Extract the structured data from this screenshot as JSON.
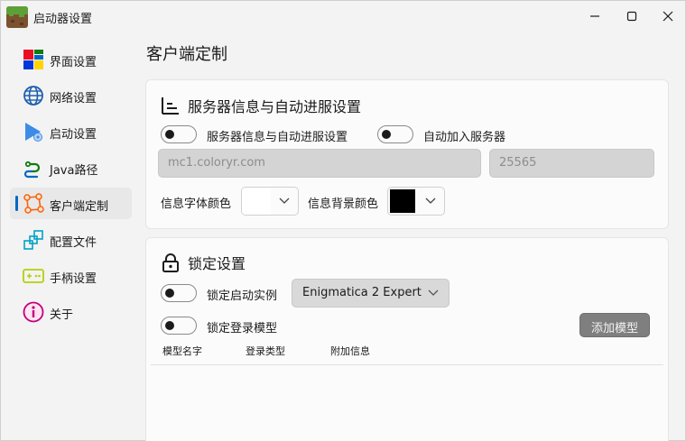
{
  "window": {
    "title": "启动器设置"
  },
  "sidebar": {
    "items": [
      {
        "label": "界面设置",
        "icon": "ui-settings-icon",
        "active": false
      },
      {
        "label": "网络设置",
        "icon": "globe-icon",
        "active": false
      },
      {
        "label": "启动设置",
        "icon": "launch-icon",
        "active": false
      },
      {
        "label": "Java路径",
        "icon": "java-path-icon",
        "active": false
      },
      {
        "label": "客户端定制",
        "icon": "client-custom-icon",
        "active": true
      },
      {
        "label": "配置文件",
        "icon": "config-file-icon",
        "active": false
      },
      {
        "label": "手柄设置",
        "icon": "gamepad-icon",
        "active": false
      },
      {
        "label": "关于",
        "icon": "info-icon",
        "active": false
      }
    ]
  },
  "main": {
    "page_title": "客户端定制",
    "server_section": {
      "title": "服务器信息与自动进服设置",
      "toggle1_label": "服务器信息与自动进服设置",
      "toggle2_label": "自动加入服务器",
      "address_placeholder": "mc1.coloryr.com",
      "port_placeholder": "25565",
      "font_color_label": "信息字体颜色",
      "font_color": "#ffffff",
      "bg_color_label": "信息背景颜色",
      "bg_color": "#000000"
    },
    "lock_section": {
      "title": "锁定设置",
      "lock_instance_label": "锁定启动实例",
      "instance_value": "Enigmatica 2 Expert",
      "lock_login_label": "锁定登录模型",
      "add_model_button": "添加模型",
      "columns": [
        "模型名字",
        "登录类型",
        "附加信息"
      ]
    }
  },
  "colors": {
    "accent": "#0067c0"
  }
}
